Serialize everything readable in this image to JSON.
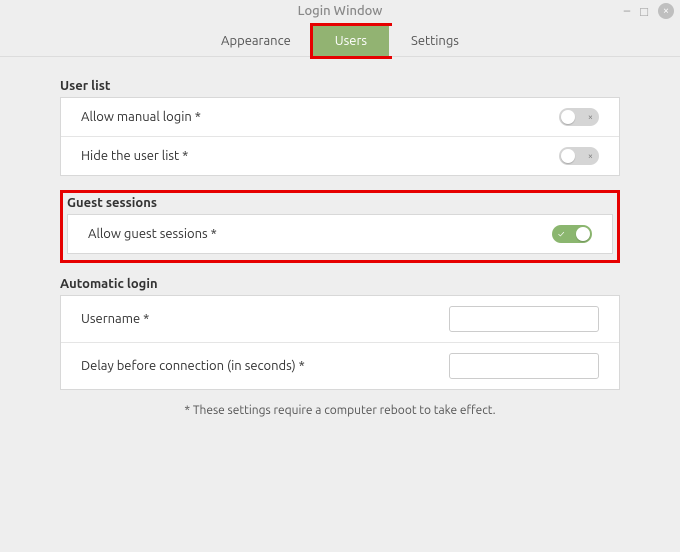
{
  "window": {
    "title": "Login Window"
  },
  "tabs": {
    "appearance": "Appearance",
    "users": "Users",
    "settings": "Settings",
    "active": "users"
  },
  "sections": {
    "userList": {
      "title": "User list",
      "allowManualLogin": {
        "label": "Allow manual login *",
        "value": false
      },
      "hideUserList": {
        "label": "Hide the user list *",
        "value": false
      }
    },
    "guestSessions": {
      "title": "Guest sessions",
      "allowGuest": {
        "label": "Allow guest sessions *",
        "value": true
      }
    },
    "automaticLogin": {
      "title": "Automatic login",
      "username": {
        "label": "Username *",
        "value": ""
      },
      "delay": {
        "label": "Delay before connection (in seconds) *",
        "value": ""
      }
    }
  },
  "footer": "* These settings require a computer reboot to take effect.",
  "highlights": {
    "usersTab": true,
    "guestSection": true
  }
}
